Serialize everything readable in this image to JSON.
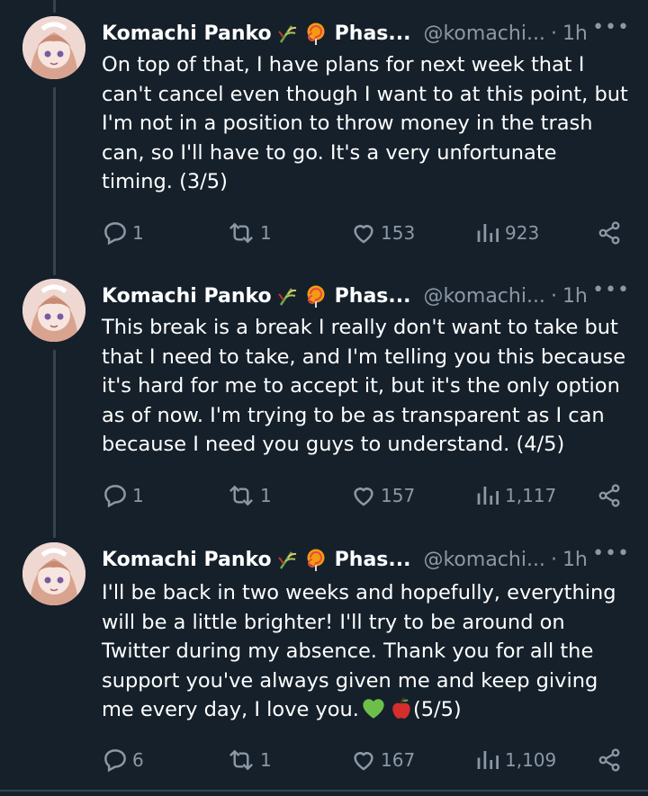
{
  "tweets": [
    {
      "author": "Komachi Panko",
      "display_suffix": "Phas...",
      "handle": "@komachi...",
      "time": "1h",
      "text": "On top of that, I have plans for next week that I can't cancel even though I want to at this point, but I'm not in a position to throw money in the trash can, so I'll have to go. It's a very unfortunate timing. (3/5)",
      "replies": "1",
      "retweets": "1",
      "likes": "153",
      "views": "923"
    },
    {
      "author": "Komachi Panko",
      "display_suffix": "Phas...",
      "handle": "@komachi...",
      "time": "1h",
      "text": "This break is a break I really don't want to take but that I need to take, and I'm telling you this because it's hard for me to accept it, but it's the only option as of now. I'm trying to be as transparent as I can because I need you guys to understand. (4/5)",
      "replies": "1",
      "retweets": "1",
      "likes": "157",
      "views": "1,117"
    },
    {
      "author": "Komachi Panko",
      "display_suffix": "Phas...",
      "handle": "@komachi...",
      "time": "1h",
      "text_before": "I'll be back in two weeks and hopefully, everything will be a little brighter! I'll try to be around on Twitter during my absence. Thank you for all the support you've always given me and keep giving me every day, I love you.",
      "text_after": "(5/5)",
      "replies": "6",
      "retweets": "1",
      "likes": "167",
      "views": "1,109"
    }
  ],
  "icons": {
    "name_emoji_1": "rice-plant-emoji",
    "name_emoji_2": "lollipop-emoji",
    "green_heart": "green-heart-emoji",
    "apple": "red-apple-emoji"
  },
  "colors": {
    "background": "#15202b",
    "muted": "#8b98a5",
    "thread_line": "#38444d"
  }
}
